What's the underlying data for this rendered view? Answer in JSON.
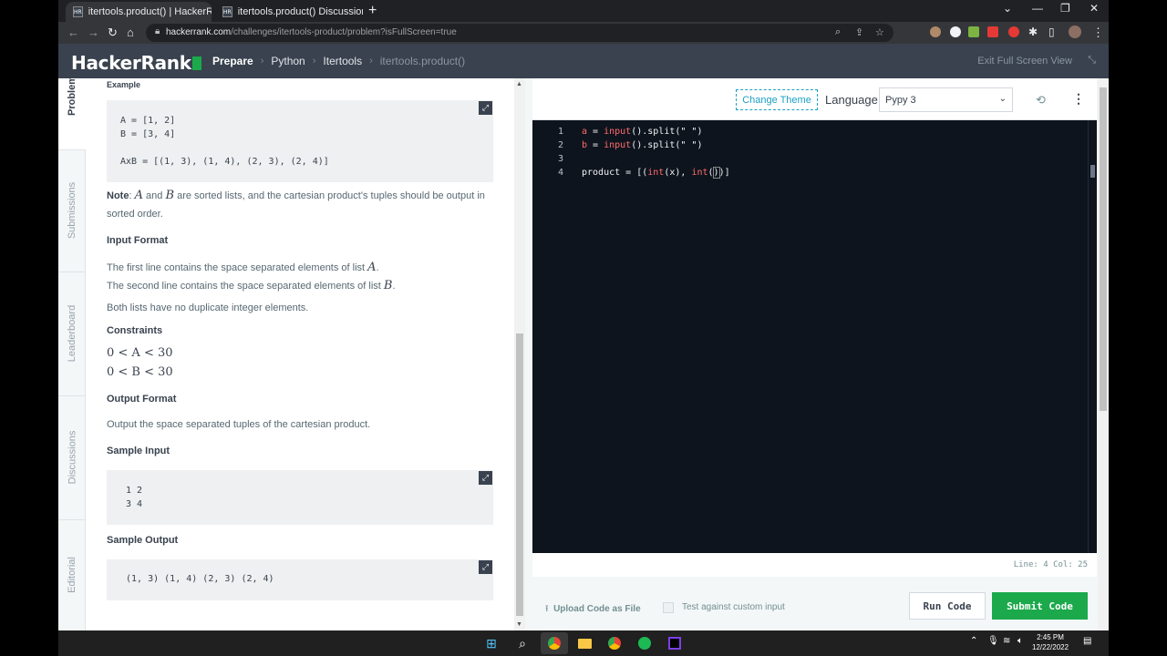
{
  "browser": {
    "tabs": [
      {
        "title": "itertools.product() | HackerRank",
        "active": true
      },
      {
        "title": "itertools.product() Discussions | H",
        "active": false
      }
    ],
    "favicon_text": "HR",
    "url_host": "hackerrank.com",
    "url_path": "/challenges/itertools-product/problem?isFullScreen=true"
  },
  "header": {
    "logo": "HackerRank",
    "breadcrumbs": [
      "Prepare",
      "Python",
      "Itertools",
      "itertools.product()"
    ],
    "exit_fullscreen": "Exit Full Screen View"
  },
  "side_tabs": [
    "Problem",
    "Submissions",
    "Leaderboard",
    "Discussions",
    "Editorial"
  ],
  "problem": {
    "example_heading": "Example",
    "example_code": "A = [1, 2]\nB = [3, 4]\n\nAxB = [(1, 3), (1, 4), (2, 3), (2, 4)]",
    "note_label": "Note",
    "note_text_1": ":",
    "note_var_a": "A",
    "note_and": "and",
    "note_var_b": "B",
    "note_text_2": "are sorted lists, and the cartesian product's tuples should be output in",
    "note_text_3": "sorted order.",
    "input_format_heading": "Input Format",
    "input_line_1": "The first line contains the space separated elements of list",
    "input_var_a": "A",
    "input_line_2": "The second line contains the space separated elements of list",
    "input_var_b": "B",
    "input_line_3": "Both lists have no duplicate integer elements.",
    "constraints_heading": "Constraints",
    "constraint_1": "0 < A < 30",
    "constraint_2": "0 < B < 30",
    "output_format_heading": "Output Format",
    "output_text": "Output the space separated tuples of the cartesian product.",
    "sample_input_heading": "Sample Input",
    "sample_input": " 1 2\n 3 4",
    "sample_output_heading": "Sample Output",
    "sample_output": " (1, 3) (1, 4) (2, 3) (2, 4)"
  },
  "editor": {
    "change_theme": "Change Theme",
    "language_label": "Language",
    "language_value": "Pypy 3",
    "line_numbers": [
      "1",
      "2",
      "3",
      "4"
    ],
    "status": "Line: 4 Col: 25",
    "upload_label": "Upload Code as File",
    "test_custom_label": "Test against custom input",
    "run_label": "Run Code",
    "submit_label": "Submit Code"
  },
  "taskbar": {
    "time": "2:45 PM",
    "date": "12/22/2022"
  },
  "colors": {
    "hr_header": "#39424e",
    "hr_green": "#1ba94c",
    "editor_bg": "#0e141e",
    "theme_link": "#1ba0c4"
  }
}
